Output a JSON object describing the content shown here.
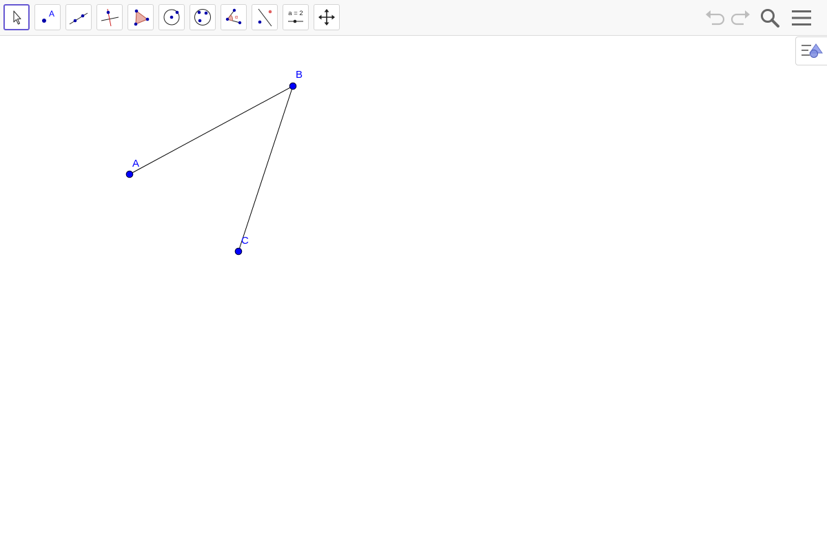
{
  "toolbar": {
    "tools": [
      {
        "name": "move",
        "icon": "move-arrow-icon",
        "selected": true
      },
      {
        "name": "point",
        "icon": "point-icon",
        "label": "A"
      },
      {
        "name": "line",
        "icon": "line-through-two-points-icon"
      },
      {
        "name": "perpendicular-line",
        "icon": "perpendicular-line-icon"
      },
      {
        "name": "polygon",
        "icon": "polygon-icon"
      },
      {
        "name": "circle",
        "icon": "circle-center-point-icon"
      },
      {
        "name": "circle-three-points",
        "icon": "circle-three-points-icon"
      },
      {
        "name": "angle",
        "icon": "angle-icon"
      },
      {
        "name": "reflect",
        "icon": "reflect-about-line-icon"
      },
      {
        "name": "slider",
        "icon": "slider-icon",
        "label": "a = 2"
      },
      {
        "name": "move-graphics-view",
        "icon": "move-graphics-view-icon"
      }
    ],
    "right": [
      {
        "name": "undo",
        "icon": "undo-icon"
      },
      {
        "name": "redo",
        "icon": "redo-icon"
      },
      {
        "name": "search",
        "icon": "search-icon"
      },
      {
        "name": "menu",
        "icon": "hamburger-menu-icon"
      }
    ]
  },
  "style_bar_toggle": {
    "icon": "style-bar-icon"
  },
  "colors": {
    "point_fill": "#0000ff",
    "point_label": "#0000ff",
    "segment": "#000000",
    "selected_tool_border": "#6557d2",
    "toolbar_bg": "#f8f8f8"
  },
  "construction": {
    "points": [
      {
        "label": "A"
      },
      {
        "label": "B"
      },
      {
        "label": "C"
      }
    ],
    "segments": [
      {
        "from": "A",
        "to": "B"
      },
      {
        "from": "B",
        "to": "C"
      }
    ]
  }
}
